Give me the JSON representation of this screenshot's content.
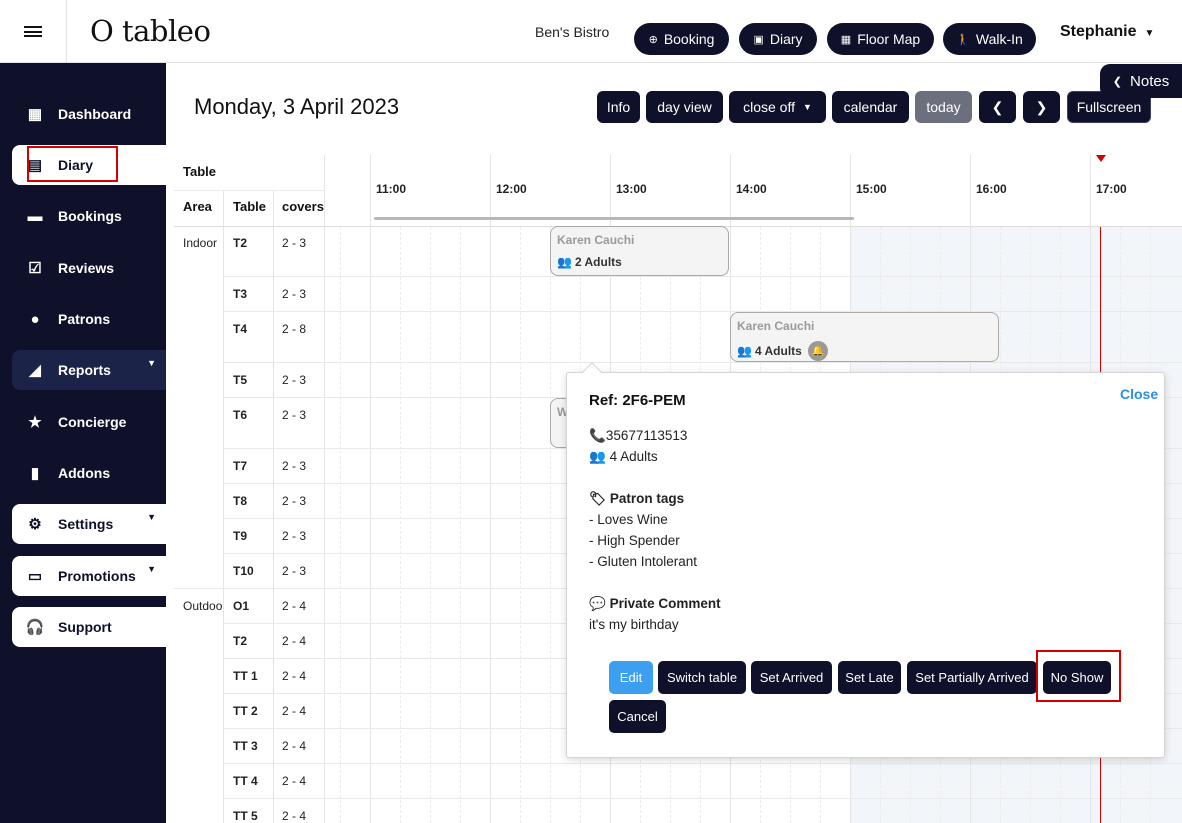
{
  "topbar": {
    "logo": "O tableo",
    "venue": "Ben's Bistro",
    "buttons": [
      {
        "label": "Booking",
        "icon": "plus-circle-icon"
      },
      {
        "label": "Diary",
        "icon": "calendar-icon"
      },
      {
        "label": "Floor Map",
        "icon": "floor-map-icon"
      },
      {
        "label": "Walk-In",
        "icon": "walking-icon"
      }
    ],
    "user": "Stephanie"
  },
  "sidebar": {
    "items": [
      {
        "label": "Dashboard",
        "icon": "dashboard-icon"
      },
      {
        "label": "Diary",
        "icon": "calendar-icon"
      },
      {
        "label": "Bookings",
        "icon": "bookings-icon"
      },
      {
        "label": "Reviews",
        "icon": "reviews-icon"
      },
      {
        "label": "Patrons",
        "icon": "person-icon"
      },
      {
        "label": "Reports",
        "icon": "chart-icon"
      },
      {
        "label": "Concierge",
        "icon": "star-icon"
      },
      {
        "label": "Addons",
        "icon": "addons-icon"
      },
      {
        "label": "Settings",
        "icon": "gear-icon"
      },
      {
        "label": "Promotions",
        "icon": "gift-icon"
      },
      {
        "label": "Support",
        "icon": "headset-icon"
      }
    ]
  },
  "header": {
    "date": "Monday, 3 April 2023",
    "buttons": [
      "Info",
      "day view",
      "close off",
      "calendar",
      "today",
      "Fullscreen"
    ],
    "notes": "Notes"
  },
  "grid": {
    "head_table": "Table",
    "col_area": "Area",
    "col_table": "Table",
    "col_covers": "covers",
    "times": [
      "11:00",
      "12:00",
      "13:00",
      "14:00",
      "15:00",
      "16:00",
      "17:00"
    ],
    "rows": [
      {
        "area": "Indoor",
        "table": "T2",
        "covers": "2 - 3"
      },
      {
        "area": "",
        "table": "T3",
        "covers": "2 - 3"
      },
      {
        "area": "",
        "table": "T4",
        "covers": "2 - 8"
      },
      {
        "area": "",
        "table": "T5",
        "covers": "2 - 3"
      },
      {
        "area": "",
        "table": "T6",
        "covers": "2 - 3"
      },
      {
        "area": "",
        "table": "T7",
        "covers": "2 - 3"
      },
      {
        "area": "",
        "table": "T8",
        "covers": "2 - 3"
      },
      {
        "area": "",
        "table": "T9",
        "covers": "2 - 3"
      },
      {
        "area": "",
        "table": "T10",
        "covers": "2 - 3"
      },
      {
        "area": "Outdoo",
        "table": "O1",
        "covers": "2 - 4"
      },
      {
        "area": "",
        "table": "T2",
        "covers": "2 - 4"
      },
      {
        "area": "",
        "table": "TT 1",
        "covers": "2 - 4"
      },
      {
        "area": "",
        "table": "TT 2",
        "covers": "2 - 4"
      },
      {
        "area": "",
        "table": "TT 3",
        "covers": "2 - 4"
      },
      {
        "area": "",
        "table": "TT 4",
        "covers": "2 - 4"
      },
      {
        "area": "",
        "table": "TT 5",
        "covers": "2 - 4"
      }
    ],
    "bookings": [
      {
        "name": "Karen Cauchi",
        "covers": "2 Adults"
      },
      {
        "name": "Karen Cauchi",
        "covers": "4 Adults"
      },
      {
        "name": "W",
        "covers": ""
      }
    ]
  },
  "popup": {
    "ref": "Ref: 2F6-PEM",
    "close": "Close",
    "phone": "35677113513",
    "covers": "4 Adults",
    "tags_title": "Patron tags",
    "tags": [
      "- Loves Wine",
      "- High Spender",
      "- Gluten Intolerant"
    ],
    "comment_title": "Private Comment",
    "comment": "it's my birthday",
    "actions": [
      "Edit",
      "Switch table",
      "Set Arrived",
      "Set Late",
      "Set Partially Arrived",
      "No Show",
      "Cancel"
    ]
  },
  "colors": {
    "navy": "#0e1129",
    "accent_blue": "#3d9ff0",
    "highlight_red": "#d40000"
  }
}
